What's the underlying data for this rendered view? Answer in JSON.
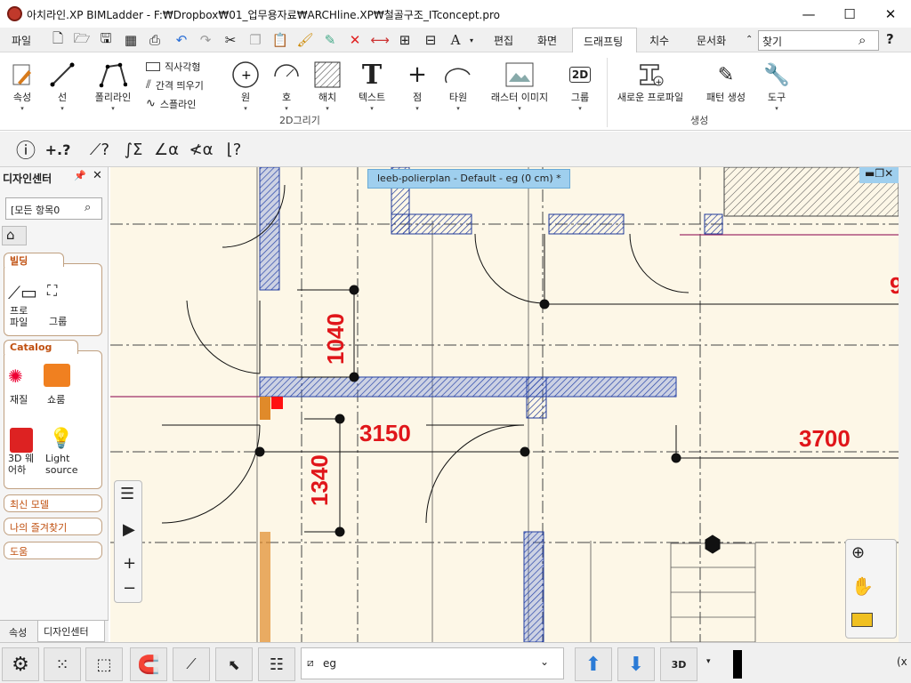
{
  "window": {
    "title": "아치라인.XP BIMLadder -  F:₩Dropbox₩01_업무용자료₩ARCHline.XP₩철골구조_ITconcept.pro"
  },
  "menu": {
    "file": "파일",
    "edit": "편집",
    "view": "화면",
    "drafting": "드래프팅",
    "dimension": "치수",
    "document": "문서화",
    "search_value": "찾기",
    "help": "?"
  },
  "ribbon": {
    "buttons": {
      "properties": "속성",
      "line": "선",
      "polyline": "폴리라인",
      "circle": "원",
      "arc": "호",
      "hatch": "해치",
      "text": "텍스트",
      "point": "점",
      "ellipse": "타원",
      "raster": "래스터 이미지",
      "group": "그룹",
      "new_profile": "새로운 프로파일",
      "pattern": "패턴 생성",
      "tools": "도구"
    },
    "small": {
      "rectangle": "직사각형",
      "offset": "간격 띄우기",
      "spline": "스플라인"
    },
    "group_labels": {
      "draw2d": "2D그리기",
      "create": "생성"
    },
    "badge_2d": "2D"
  },
  "leftpanel": {
    "title": "디자인센터",
    "search_value": "[모든 항목0",
    "building": {
      "label": "빌딩",
      "profile": "프로\n파일",
      "group": "그룹"
    },
    "catalog": {
      "label": "Catalog",
      "material": "재질",
      "sofa": "쇼룸",
      "web3d": "3D 웨\n어하",
      "light": "Light\nsource"
    },
    "recent": "최신 모델",
    "favorites": "나의 즐겨찾기",
    "help": "도움",
    "tabs": {
      "properties": "속성",
      "designcenter": "디자인센터"
    }
  },
  "canvas": {
    "tab_title": "leeb-polierplan - Default - eg (0 cm) *",
    "dims": {
      "d1040": "1040",
      "d1340": "1340",
      "d3150": "3150",
      "d3700": "3700",
      "d9": "9"
    }
  },
  "statusbar": {
    "layer_value": "eg",
    "hammer_label": "3D",
    "coord": "(x"
  },
  "colors": {
    "wall": "#3f63d9",
    "dim": "#e0161a",
    "bg": "#fdf7e7",
    "active_tab": "#9fcfee"
  }
}
